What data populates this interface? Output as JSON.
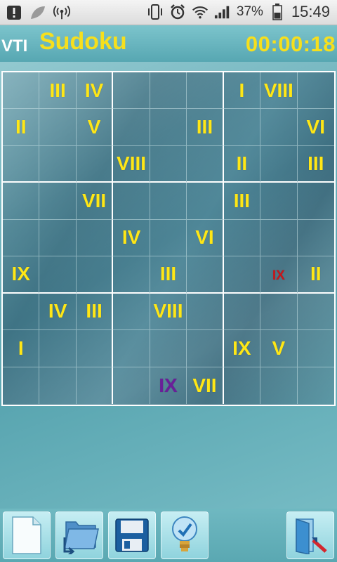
{
  "status_bar": {
    "battery_percent": "37%",
    "time": "15:49"
  },
  "header": {
    "brand": "VTI",
    "title": "Sudoku",
    "timer": "00:00:18"
  },
  "board": {
    "rows": [
      [
        "",
        "III",
        "IV",
        "",
        "",
        "",
        "I",
        "VIII",
        ""
      ],
      [
        "II",
        "",
        "V",
        "",
        "",
        "III",
        "",
        "",
        "VI"
      ],
      [
        "",
        "",
        "",
        "VIII",
        "",
        "",
        "II",
        "",
        "III"
      ],
      [
        "",
        "",
        "VII",
        "",
        "",
        "",
        "III",
        "",
        ""
      ],
      [
        "",
        "",
        "",
        "IV",
        "",
        "VI",
        "",
        "",
        ""
      ],
      [
        "IX",
        "",
        "",
        "",
        "III",
        "",
        "",
        "IX",
        "II"
      ],
      [
        "",
        "IV",
        "III",
        "",
        "VIII",
        "",
        "",
        "",
        ""
      ],
      [
        "I",
        "",
        "",
        "",
        "",
        "",
        "IX",
        "V",
        ""
      ],
      [
        "",
        "",
        "",
        "",
        "IX",
        "VII",
        "",
        "",
        ""
      ]
    ],
    "hint_cells": [
      [
        5,
        7
      ]
    ],
    "user_cells": [
      [
        8,
        4
      ]
    ]
  },
  "colors": {
    "given": "#ffe716",
    "hint": "#c8161b",
    "user": "#6a1f99",
    "accent": "#f6df1d"
  },
  "toolbar": {
    "buttons": [
      {
        "name": "new-game-button",
        "icon": "new-document-icon"
      },
      {
        "name": "open-game-button",
        "icon": "open-folder-icon"
      },
      {
        "name": "save-game-button",
        "icon": "floppy-disk-icon"
      },
      {
        "name": "hint-button",
        "icon": "lightbulb-icon"
      },
      {
        "name": "exit-button",
        "icon": "exit-door-icon"
      }
    ]
  }
}
